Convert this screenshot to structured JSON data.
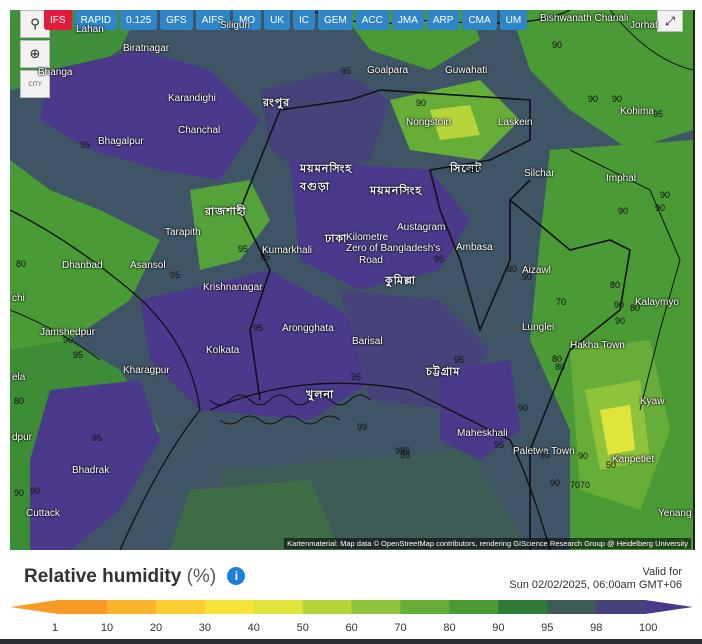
{
  "toolbar": {
    "models": [
      "IFS",
      "RAPID",
      "0.125",
      "GFS",
      "AIFS",
      "MO",
      "UK",
      "IC",
      "GEM",
      "ACC",
      "JMA",
      "ARP",
      "CMA",
      "UM"
    ],
    "active_model": "IFS",
    "tools": [
      {
        "name": "marker-icon",
        "glyph": "⚲"
      },
      {
        "name": "zoom-icon",
        "glyph": "⊕"
      },
      {
        "name": "city-icon",
        "glyph": "CITY"
      }
    ],
    "fullscreen_glyph": "⤢"
  },
  "map": {
    "attribution": "Kartenmaterial: Map data © OpenStreetMap contributors, rendering GIScience Research Group @ Heidelberg University",
    "places": [
      {
        "name": "Lahan",
        "big": false
      },
      {
        "name": "Siliguri",
        "big": false
      },
      {
        "name": "Biratnagar",
        "big": false
      },
      {
        "name": "Bhanga",
        "big": false
      },
      {
        "name": "Karandighi",
        "big": false
      },
      {
        "name": "রংপুর",
        "big": true
      },
      {
        "name": "Goalpara",
        "big": false
      },
      {
        "name": "Guwahati",
        "big": false
      },
      {
        "name": "Bishwanath Chariali",
        "big": false
      },
      {
        "name": "Jorhat",
        "big": false
      },
      {
        "name": "Nongstoin",
        "big": false
      },
      {
        "name": "Laskein",
        "big": false
      },
      {
        "name": "Kohima",
        "big": false
      },
      {
        "name": "Chanchal",
        "big": false
      },
      {
        "name": "Bhagalpur",
        "big": false
      },
      {
        "name": "ময়মনসিংহ",
        "big": true
      },
      {
        "name": "বগুড়া",
        "big": true
      },
      {
        "name": "ময়মনসিংহ",
        "big": true
      },
      {
        "name": "সিলেট",
        "big": true
      },
      {
        "name": "Silchar",
        "big": false
      },
      {
        "name": "Imphal",
        "big": false
      },
      {
        "name": "রাজশাহী",
        "big": true
      },
      {
        "name": "Austagram",
        "big": false
      },
      {
        "name": "Tarapith",
        "big": false
      },
      {
        "name": "ঢাকা",
        "big": true
      },
      {
        "name": "Kilometre",
        "big": false
      },
      {
        "name": "Zero of Bangladesh's",
        "big": false
      },
      {
        "name": "Road",
        "big": false
      },
      {
        "name": "Kumarkhali",
        "big": false
      },
      {
        "name": "Ambasa",
        "big": false
      },
      {
        "name": "Aizawl",
        "big": false
      },
      {
        "name": "Dhanbad",
        "big": false
      },
      {
        "name": "Asansol",
        "big": false
      },
      {
        "name": "Krishnanagar",
        "big": false
      },
      {
        "name": "কুমিল্লা",
        "big": true
      },
      {
        "name": "chi",
        "big": false
      },
      {
        "name": "Kalaymyo",
        "big": false
      },
      {
        "name": "Jamshedpur",
        "big": false
      },
      {
        "name": "Arongghata",
        "big": false
      },
      {
        "name": "Lunglei",
        "big": false
      },
      {
        "name": "Kolkata",
        "big": false
      },
      {
        "name": "Barisal",
        "big": false
      },
      {
        "name": "Hakha Town",
        "big": false
      },
      {
        "name": "Kharagpur",
        "big": false
      },
      {
        "name": "চট্টগ্রাম",
        "big": true
      },
      {
        "name": "ela",
        "big": false
      },
      {
        "name": "খুলনা",
        "big": true
      },
      {
        "name": "Kyaw",
        "big": false
      },
      {
        "name": "dpur",
        "big": false
      },
      {
        "name": "Maheskhali",
        "big": false
      },
      {
        "name": "Paletwa Town",
        "big": false
      },
      {
        "name": "Kanpetlet",
        "big": false
      },
      {
        "name": "Bhadrak",
        "big": false
      },
      {
        "name": "Cuttack",
        "big": false
      },
      {
        "name": "Yenang",
        "big": false
      }
    ],
    "contour_labels": [
      "90",
      "95",
      "90",
      "95",
      "95",
      "90",
      "90",
      "90",
      "80",
      "95",
      "80",
      "95",
      "80",
      "90",
      "95",
      "95",
      "95",
      "80",
      "80",
      "95",
      "95",
      "90",
      "90",
      "70",
      "90",
      "95",
      "80",
      "90",
      "90",
      "95",
      "95",
      "95",
      "99",
      "90",
      "95",
      "90",
      "70",
      "90",
      "90",
      "95",
      "80",
      "50",
      "70",
      "95",
      "90",
      "90",
      "95"
    ]
  },
  "legend": {
    "title": "Relative humidity",
    "unit": "(%)",
    "valid_label": "Valid for",
    "valid_time": "Sun 02/02/2025, 06:00am GMT+06",
    "ticks": [
      "1",
      "10",
      "20",
      "30",
      "40",
      "50",
      "60",
      "70",
      "80",
      "90",
      "95",
      "98",
      "100"
    ],
    "colors": [
      "#f79b25",
      "#fab52f",
      "#fbce34",
      "#f7e43a",
      "#dfe53a",
      "#b7d53a",
      "#8fc33b",
      "#67ae39",
      "#4a9a36",
      "#2f7a34",
      "#3e5c55",
      "#46437a",
      "#4b3a8c"
    ]
  }
}
